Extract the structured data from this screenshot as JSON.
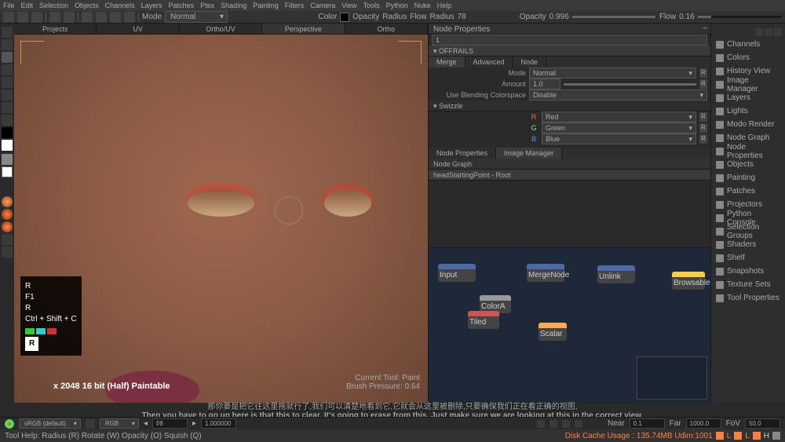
{
  "menubar": [
    "File",
    "Edit",
    "Selection",
    "Objects",
    "Channels",
    "Layers",
    "Patches",
    "Ptex",
    "Shading",
    "Painting",
    "Filters",
    "Camera",
    "View",
    "Tools",
    "Python",
    "Nuke",
    "Help"
  ],
  "controls": {
    "mode_label": "Mode",
    "mode_value": "Normal",
    "color_label": "Color",
    "opacity_label": "Opacity",
    "radius_label": "Radius",
    "flow_label": "Flow",
    "radius_value": "78",
    "opacity_value": "0.996",
    "flow_value": "0.16"
  },
  "viewport_tabs": [
    "Projects",
    "UV",
    "Ortho/UV",
    "Perspective",
    "Ortho"
  ],
  "active_tab": 3,
  "hotkeys": {
    "l1": "R",
    "l2": "F1",
    "l3": "R",
    "l4": "Ctrl + Shift + C",
    "badge": "R"
  },
  "info_text": "x 2048 16 bit (Half) Paintable",
  "tool_info_l1": "Current Tool: Paint",
  "tool_info_l2": "Brush Pressure: 0.64",
  "props": {
    "title": "Node Properties",
    "search": "1",
    "section": "OFFRAILS",
    "subtabs": [
      "Merge",
      "Advanced",
      "Node"
    ],
    "mode_l": "Mode",
    "mode_v": "Normal",
    "amount_l": "Amount",
    "amount_v": "1.0",
    "blend_l": "Use Blending Colorspace",
    "blend_v": "Disable",
    "swizzle": "Swizzle",
    "r": "Red",
    "g": "Green",
    "b": "Blue",
    "nodeprops_tab": "Node Properties",
    "imgmgr_tab": "Image Manager",
    "nodegraph": "Node Graph",
    "path": "headStartingPoint - Root"
  },
  "nodes": {
    "n1": "Input",
    "n2": "ColorA",
    "n3": "Tiled",
    "n4": "MergeNode",
    "n5": "Scalar",
    "n6": "Unlink",
    "n7": "Browsable"
  },
  "side_panel": [
    "Channels",
    "Colors",
    "History View",
    "Image Manager",
    "Layers",
    "Lights",
    "Modo Render",
    "Node Graph",
    "Node Properties",
    "Objects",
    "Painting",
    "Patches",
    "Projectors",
    "Python Console",
    "Selection Groups",
    "Shaders",
    "Shelf",
    "Snapshots",
    "Texture Sets",
    "Tool Properties"
  ],
  "subtitle_cn": "那你要是把它往这里拖就行了,我们可以清楚地看到它,它就会从这里被删除,只要确保我们正在看正确的视图,",
  "subtitle_en": "Then you have to go up here is that this to clear, It's going to erase from this, Just make sure we are looking at this in the correct view,",
  "status": {
    "colorspace": "sRGB (default)",
    "channel": "RGB",
    "fstop": "f/8",
    "exposure": "1.000000",
    "near": "Near",
    "near_v": "0.1",
    "far": "Far",
    "far_v": "1000.0",
    "fov": "FoV",
    "fov_v": "50.0"
  },
  "help": "Tool Help:    Radius (R)   Rotate (W)   Opacity (O)   Squish (Q)",
  "cache": "Disk Cache Usage : 135.74MB  Udim:1001"
}
